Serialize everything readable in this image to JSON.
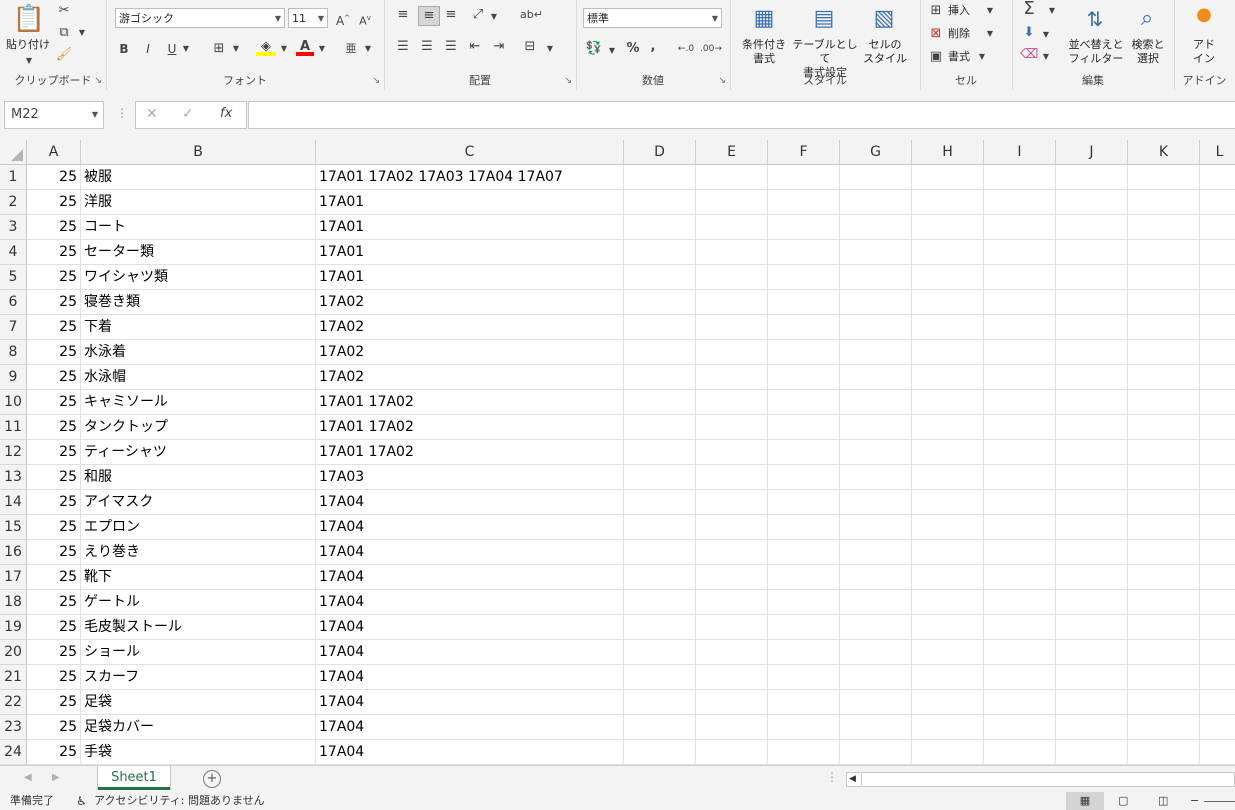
{
  "ribbon": {
    "clipboard": {
      "paste_label": "貼り付け",
      "group_label": "クリップボード"
    },
    "font": {
      "family": "游ゴシック",
      "size": "11",
      "group_label": "フォント",
      "bold": "B",
      "italic": "I",
      "underline": "U"
    },
    "alignment": {
      "group_label": "配置"
    },
    "number": {
      "format": "標準",
      "group_label": "数値",
      "percent": "%",
      "comma": ","
    },
    "styles": {
      "conditional_label": "条件付き\n書式",
      "table_label": "テーブルとして\n書式設定",
      "cell_style_label": "セルの\nスタイル",
      "group_label": "スタイル"
    },
    "cells": {
      "insert_label": "挿入",
      "delete_label": "削除",
      "format_label": "書式",
      "group_label": "セル"
    },
    "editing": {
      "sort_label": "並べ替えと\nフィルター",
      "find_label": "検索と\n選択",
      "group_label": "編集"
    },
    "addins": {
      "label": "アド\nイン",
      "group_label": "アドイン"
    }
  },
  "formula_bar": {
    "name_box": "M22",
    "fx": "fx",
    "cancel": "✕",
    "enter": "✓",
    "value": ""
  },
  "columns": [
    {
      "name": "A",
      "width": 54
    },
    {
      "name": "B",
      "width": 235
    },
    {
      "name": "C",
      "width": 308
    },
    {
      "name": "D",
      "width": 72
    },
    {
      "name": "E",
      "width": 72
    },
    {
      "name": "F",
      "width": 72
    },
    {
      "name": "G",
      "width": 72
    },
    {
      "name": "H",
      "width": 72
    },
    {
      "name": "I",
      "width": 72
    },
    {
      "name": "J",
      "width": 72
    },
    {
      "name": "K",
      "width": 72
    },
    {
      "name": "L",
      "width": 40
    }
  ],
  "rows": [
    {
      "n": "1",
      "a": "25",
      "b": "被服",
      "c": "17A01 17A02 17A03 17A04 17A07"
    },
    {
      "n": "2",
      "a": "25",
      "b": "洋服",
      "c": "17A01"
    },
    {
      "n": "3",
      "a": "25",
      "b": "コート",
      "c": "17A01"
    },
    {
      "n": "4",
      "a": "25",
      "b": "セーター類",
      "c": "17A01"
    },
    {
      "n": "5",
      "a": "25",
      "b": "ワイシャツ類",
      "c": "17A01"
    },
    {
      "n": "6",
      "a": "25",
      "b": "寝巻き類",
      "c": "17A02"
    },
    {
      "n": "7",
      "a": "25",
      "b": "下着",
      "c": "17A02"
    },
    {
      "n": "8",
      "a": "25",
      "b": "水泳着",
      "c": "17A02"
    },
    {
      "n": "9",
      "a": "25",
      "b": "水泳帽",
      "c": "17A02"
    },
    {
      "n": "10",
      "a": "25",
      "b": "キャミソール",
      "c": "17A01 17A02"
    },
    {
      "n": "11",
      "a": "25",
      "b": "タンクトップ",
      "c": "17A01 17A02"
    },
    {
      "n": "12",
      "a": "25",
      "b": "ティーシャツ",
      "c": "17A01 17A02"
    },
    {
      "n": "13",
      "a": "25",
      "b": "和服",
      "c": "17A03"
    },
    {
      "n": "14",
      "a": "25",
      "b": "アイマスク",
      "c": "17A04"
    },
    {
      "n": "15",
      "a": "25",
      "b": "エプロン",
      "c": "17A04"
    },
    {
      "n": "16",
      "a": "25",
      "b": "えり巻き",
      "c": "17A04"
    },
    {
      "n": "17",
      "a": "25",
      "b": "靴下",
      "c": "17A04"
    },
    {
      "n": "18",
      "a": "25",
      "b": "ゲートル",
      "c": "17A04"
    },
    {
      "n": "19",
      "a": "25",
      "b": "毛皮製ストール",
      "c": "17A04"
    },
    {
      "n": "20",
      "a": "25",
      "b": "ショール",
      "c": "17A04"
    },
    {
      "n": "21",
      "a": "25",
      "b": "スカーフ",
      "c": "17A04"
    },
    {
      "n": "22",
      "a": "25",
      "b": "足袋",
      "c": "17A04"
    },
    {
      "n": "23",
      "a": "25",
      "b": "足袋カバー",
      "c": "17A04"
    },
    {
      "n": "24",
      "a": "25",
      "b": "手袋",
      "c": "17A04"
    }
  ],
  "sheets": {
    "active": "Sheet1",
    "add": "+"
  },
  "status": {
    "ready": "準備完了",
    "accessibility": "アクセシビリティ: 問題ありません"
  },
  "colors": {
    "accent": "#217346",
    "ribbon_bg": "#f3f3f3"
  }
}
